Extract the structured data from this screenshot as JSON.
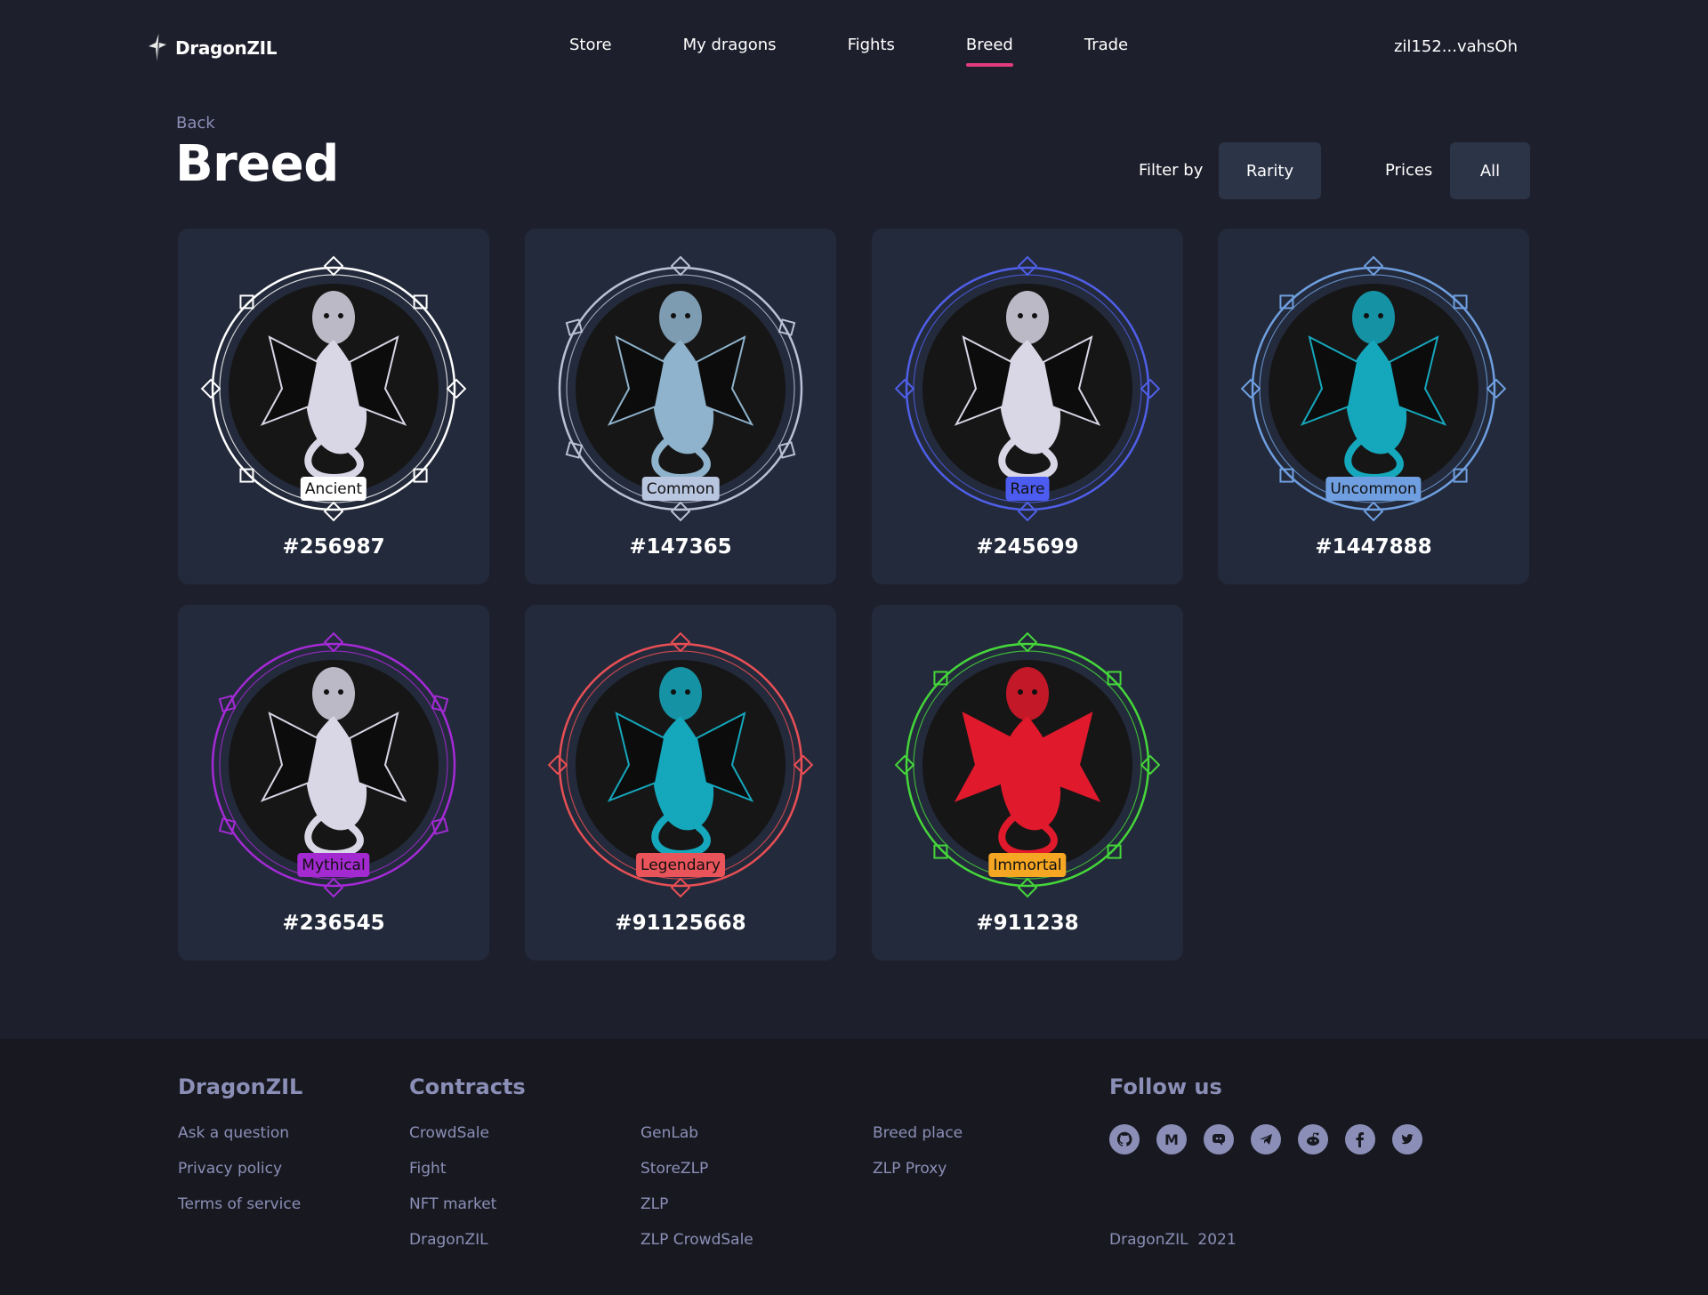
{
  "header": {
    "brand": "DragonZIL",
    "nav": [
      {
        "label": "Store",
        "active": false
      },
      {
        "label": "My dragons",
        "active": false
      },
      {
        "label": "Fights",
        "active": false
      },
      {
        "label": "Breed",
        "active": true
      },
      {
        "label": "Trade",
        "active": false
      }
    ],
    "wallet": "zil152...vahsOh"
  },
  "page": {
    "back": "Back",
    "title": "Breed",
    "filter_label": "Filter by",
    "filter_value": "Rarity",
    "prices_label": "Prices",
    "prices_value": "All"
  },
  "dragons": [
    {
      "id": "#256987",
      "rarity": "Ancient",
      "ring_color": "#ffffff",
      "badge_color": "#ffffff",
      "dragon_color": "#d9d6e6",
      "icon": "ancient-frame"
    },
    {
      "id": "#147365",
      "rarity": "Common",
      "ring_color": "#b9c1d6",
      "badge_color": "#b9c6e0",
      "dragon_color": "#8fb3cc",
      "icon": "common-frame"
    },
    {
      "id": "#245699",
      "rarity": "Rare",
      "ring_color": "#4f5fe8",
      "badge_color": "#4d5cf0",
      "dragon_color": "#d9d6e6",
      "icon": "rare-frame"
    },
    {
      "id": "#1447888",
      "rarity": "Uncommon",
      "ring_color": "#6f9fe0",
      "badge_color": "#6f9fe0",
      "dragon_color": "#15a8bd",
      "icon": "uncommon-frame"
    },
    {
      "id": "#236545",
      "rarity": "Mythical",
      "ring_color": "#a42ad6",
      "badge_color": "#a32ad1",
      "dragon_color": "#d9d6e6",
      "icon": "mythical-frame"
    },
    {
      "id": "#91125668",
      "rarity": "Legendary",
      "ring_color": "#e84f55",
      "badge_color": "#e9545b",
      "dragon_color": "#15a8bd",
      "icon": "legendary-frame"
    },
    {
      "id": "#911238",
      "rarity": "Immortal",
      "ring_color": "#45d63b",
      "badge_color": "#f5a623",
      "dragon_color": "#e0192c",
      "icon": "immortal-frame"
    }
  ],
  "footer": {
    "brand": "DragonZIL",
    "brand_links": [
      "Ask a question",
      "Privacy policy",
      "Terms of service"
    ],
    "contracts_title": "Contracts",
    "contracts_col1": [
      "CrowdSale",
      "Fight",
      "NFT market",
      "DragonZIL"
    ],
    "contracts_col2": [
      "GenLab",
      "StoreZLP",
      "ZLP",
      "ZLP CrowdSale"
    ],
    "contracts_col3": [
      "Breed place",
      "ZLP Proxy"
    ],
    "follow_title": "Follow us",
    "social": [
      "github-icon",
      "medium-icon",
      "discord-icon",
      "telegram-icon",
      "reddit-icon",
      "facebook-icon",
      "twitter-icon"
    ],
    "copyright": "DragonZIL  2021"
  }
}
